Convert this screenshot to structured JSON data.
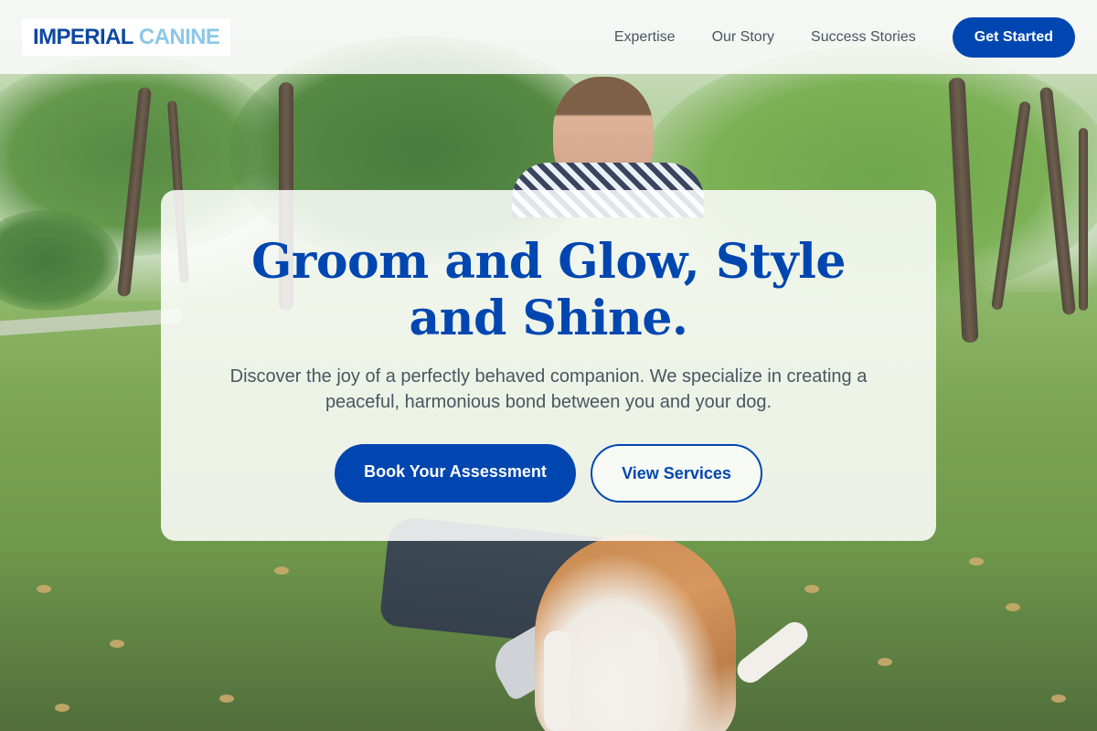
{
  "brand": {
    "word1": "IMPERIAL",
    "word2": "CANINE"
  },
  "nav": {
    "links": [
      "Expertise",
      "Our Story",
      "Success Stories"
    ],
    "cta_label": "Get Started"
  },
  "hero": {
    "title": "Groom and Glow, Style and Shine.",
    "subtitle": "Discover the joy of a perfectly behaved companion. We specialize in creating a peaceful, harmonious bond between you and your dog.",
    "primary_button": "Book Your Assessment",
    "secondary_button": "View Services"
  },
  "colors": {
    "primary": "#0046b0",
    "brand_light": "#8cc7e8",
    "text_muted": "#4a5560"
  }
}
